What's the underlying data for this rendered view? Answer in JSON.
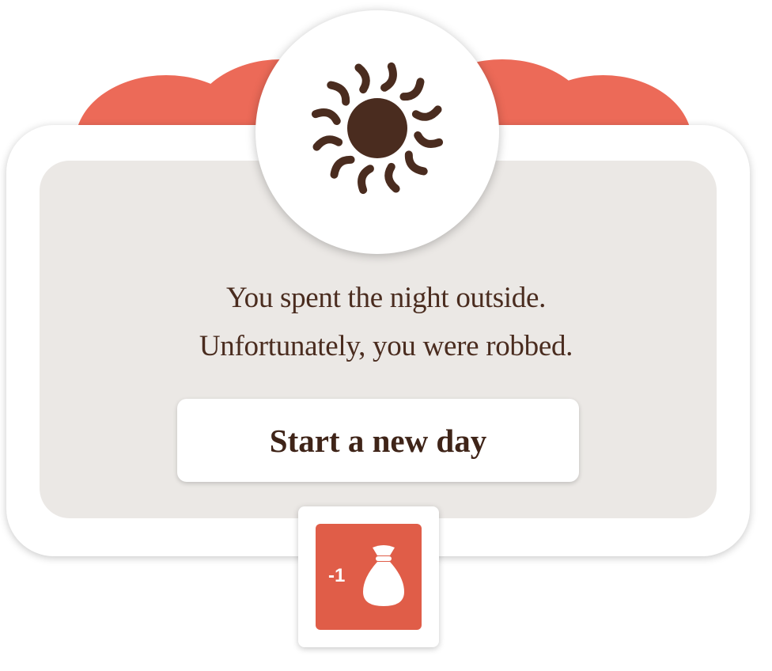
{
  "dialog": {
    "icon": "sun-icon",
    "message_line1": "You spent the night outside.",
    "message_line2": "Unfortunately, you were robbed.",
    "button_label": "Start a new day"
  },
  "effect": {
    "amount": "-1",
    "icon": "money-bag-icon"
  },
  "colors": {
    "accent_red": "#ec6a58",
    "tile_red": "#e05d48",
    "text_brown": "#4a2c1f",
    "panel_gray": "#ebe8e5"
  }
}
